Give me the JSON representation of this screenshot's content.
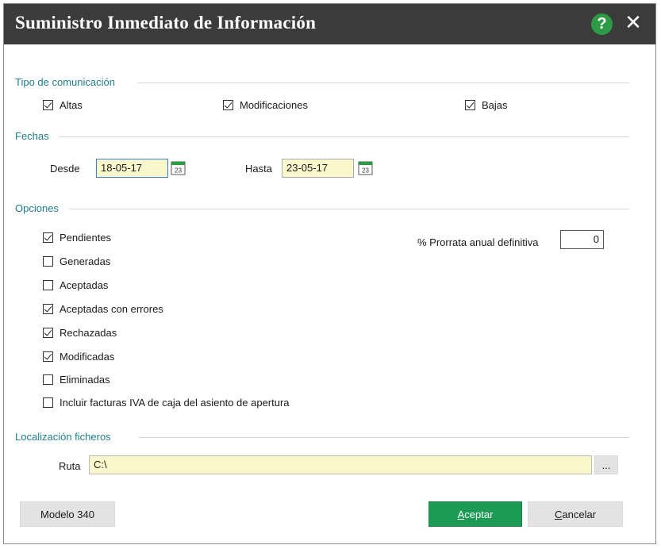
{
  "window": {
    "title": "Suministro Inmediato de Información",
    "help_label": "?",
    "close_label": "✕"
  },
  "tipo": {
    "section": "Tipo de comunicación",
    "items": [
      {
        "label": "Altas",
        "checked": true
      },
      {
        "label": "Modificaciones",
        "checked": true
      },
      {
        "label": "Bajas",
        "checked": true
      }
    ]
  },
  "fechas": {
    "section": "Fechas",
    "desde_label": "Desde",
    "desde_value": "18-05-17",
    "hasta_label": "Hasta",
    "hasta_value": "23-05-17",
    "calendar_day": "23"
  },
  "opciones": {
    "section": "Opciones",
    "items": [
      {
        "label": "Pendientes",
        "checked": true
      },
      {
        "label": "Generadas",
        "checked": false
      },
      {
        "label": "Aceptadas",
        "checked": false
      },
      {
        "label": "Aceptadas con errores",
        "checked": true
      },
      {
        "label": "Rechazadas",
        "checked": true
      },
      {
        "label": "Modificadas",
        "checked": true
      },
      {
        "label": "Eliminadas",
        "checked": false
      },
      {
        "label": "Incluir facturas IVA de caja del asiento de apertura",
        "checked": false
      }
    ],
    "prorrata_label": "% Prorrata anual definitiva",
    "prorrata_value": "0"
  },
  "localizacion": {
    "section": "Localización ficheros",
    "ruta_label": "Ruta",
    "ruta_value": "C:\\",
    "browse_label": "..."
  },
  "buttons": {
    "modelo": "Modelo 340",
    "aceptar_first": "A",
    "aceptar_rest": "ceptar",
    "cancelar_first": "C",
    "cancelar_rest": "ancelar"
  },
  "colors": {
    "titlebar": "#3b3b3b",
    "section_text": "#1f7d8a",
    "accept": "#1d9a54",
    "date_fill": "#fbf7cc"
  }
}
